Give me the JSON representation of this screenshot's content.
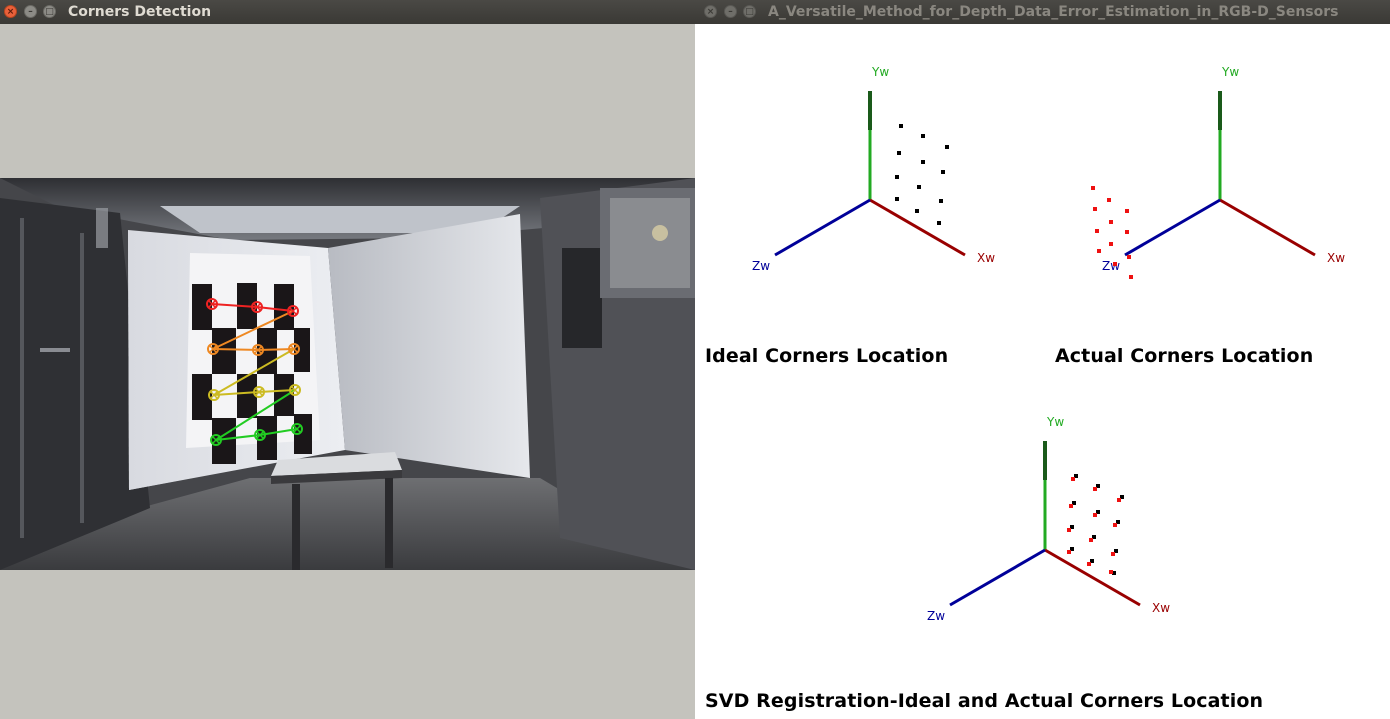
{
  "left_window": {
    "title": "Corners Detection",
    "buttons": {
      "close": "×",
      "minimize": "–",
      "maximize": "□"
    }
  },
  "right_window": {
    "title": "A_Versatile_Method_for_Depth_Data_Error_Estimation_in_RGB-D_Sensors",
    "buttons": {
      "close": "×",
      "minimize": "–",
      "maximize": "□"
    }
  },
  "axis_labels": {
    "x": "Xw",
    "y": "Yw",
    "z": "Zw"
  },
  "axis_colors": {
    "x": "#990000",
    "y": "#22aa22",
    "z": "#000099"
  },
  "corner_colors": [
    "#ee2222",
    "#ee8822",
    "#ccbb22",
    "#22cc22"
  ],
  "plots": {
    "ideal": {
      "caption": "Ideal Corners Location"
    },
    "actual": {
      "caption": "Actual Corners Location"
    },
    "svd": {
      "caption": "SVD Registration-Ideal and Actual Corners Location"
    }
  }
}
